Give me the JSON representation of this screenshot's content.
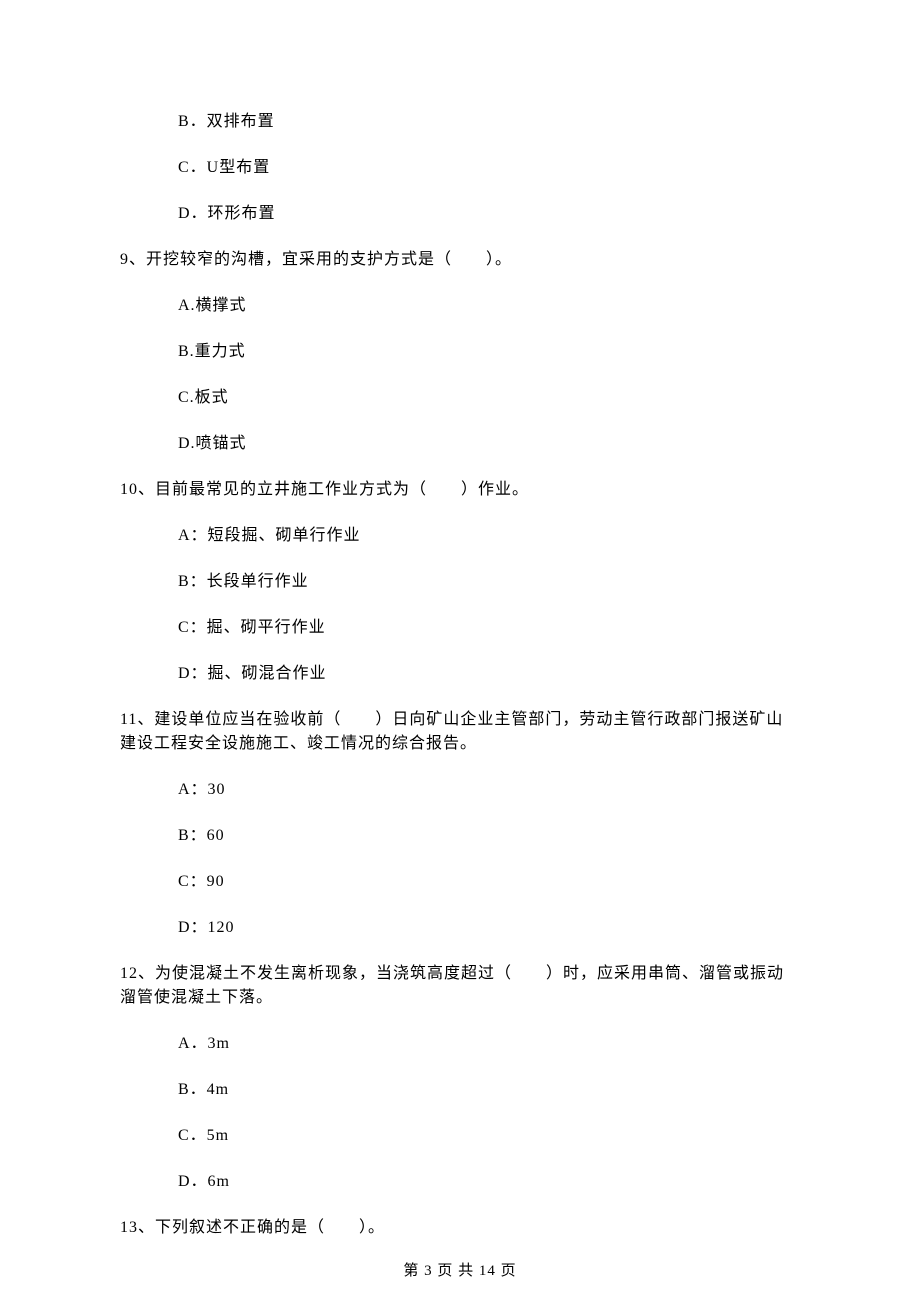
{
  "q8": {
    "optB": "B．双排布置",
    "optC": "C．U型布置",
    "optD": "D．环形布置"
  },
  "q9": {
    "stem": "9、开挖较窄的沟槽，宜采用的支护方式是（　　）。",
    "optA": "A.横撑式",
    "optB": "B.重力式",
    "optC": "C.板式",
    "optD": "D.喷锚式"
  },
  "q10": {
    "stem": "10、目前最常见的立井施工作业方式为（　　）作业。",
    "optA": "A：短段掘、砌单行作业",
    "optB": "B：长段单行作业",
    "optC": "C：掘、砌平行作业",
    "optD": "D：掘、砌混合作业"
  },
  "q11": {
    "stem": "11、建设单位应当在验收前（　　）日向矿山企业主管部门，劳动主管行政部门报送矿山建设工程安全设施施工、竣工情况的综合报告。",
    "optA": "A：30",
    "optB": "B：60",
    "optC": "C：90",
    "optD": "D：120"
  },
  "q12": {
    "stem": "12、为使混凝土不发生离析现象，当浇筑高度超过（　　）时，应采用串筒、溜管或振动溜管使混凝土下落。",
    "optA": "A．3m",
    "optB": "B．4m",
    "optC": "C．5m",
    "optD": "D．6m"
  },
  "q13": {
    "stem": "13、下列叙述不正确的是（　　）。"
  },
  "footer": "第 3 页 共 14 页"
}
